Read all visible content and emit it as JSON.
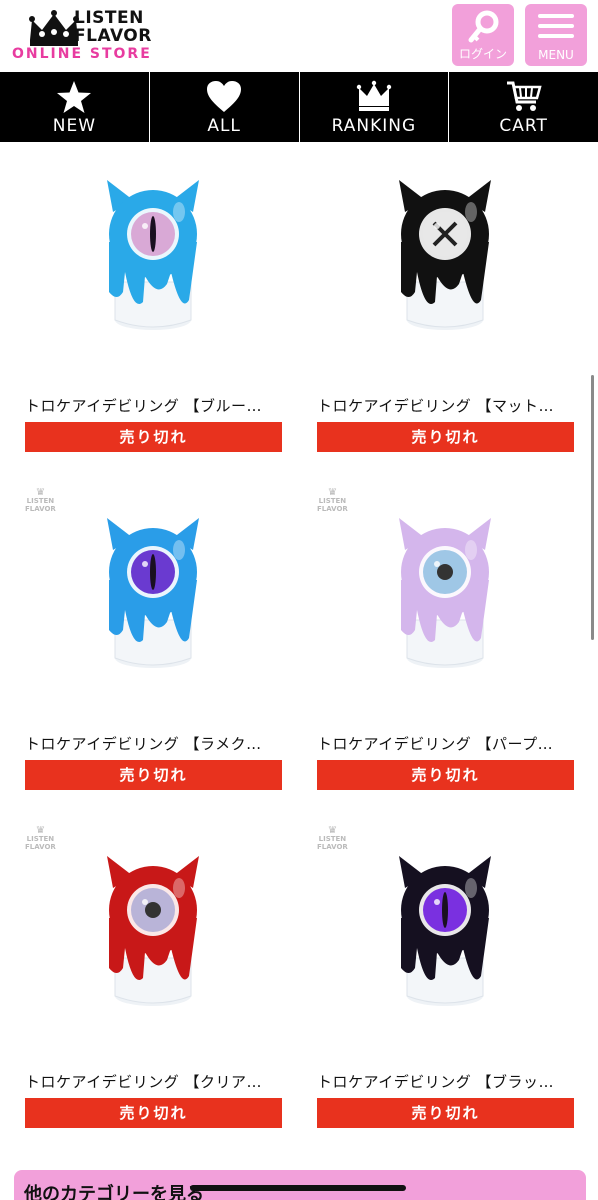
{
  "brand": {
    "line1": "LISTEN",
    "line2": "FLAVOR",
    "line3": "ONLINE STORE",
    "accent_color": "#e83ca0"
  },
  "header": {
    "login_label": "ログイン",
    "menu_label": "MENU",
    "button_color": "#f2a0da"
  },
  "nav": {
    "items": [
      {
        "label": "NEW",
        "icon": "star-icon"
      },
      {
        "label": "ALL",
        "icon": "heart-icon"
      },
      {
        "label": "RANKING",
        "icon": "crown-icon"
      },
      {
        "label": "CART",
        "icon": "cart-icon"
      }
    ]
  },
  "products": [
    {
      "name": "トロケアイデビリング 【ブルー…",
      "status": "売り切れ",
      "body_color": "#2aa9e8",
      "eye_color": "#d9a9d6",
      "pupil": "slit",
      "has_watermark": false
    },
    {
      "name": "トロケアイデビリング 【マット…",
      "status": "売り切れ",
      "body_color": "#111111",
      "eye_color": "#e8e8e8",
      "pupil": "x",
      "has_watermark": false
    },
    {
      "name": "トロケアイデビリング 【ラメク…",
      "status": "売り切れ",
      "body_color": "#2a9de8",
      "eye_color": "#6a3ad0",
      "pupil": "slit",
      "has_watermark": true
    },
    {
      "name": "トロケアイデビリング 【パープ…",
      "status": "売り切れ",
      "body_color": "#d4b6ec",
      "eye_color": "#9fc7e6",
      "pupil": "round",
      "has_watermark": true
    },
    {
      "name": "トロケアイデビリング 【クリア…",
      "status": "売り切れ",
      "body_color": "#c81818",
      "eye_color": "#b9b4d8",
      "pupil": "round",
      "has_watermark": true
    },
    {
      "name": "トロケアイデビリング 【ブラッ…",
      "status": "売り切れ",
      "body_color": "#151020",
      "eye_color": "#7a30e0",
      "pupil": "slit",
      "has_watermark": true
    }
  ],
  "watermark": {
    "line1": "LISTEN",
    "line2": "FLAVOR"
  },
  "footer": {
    "category_label": "他のカテゴリーを見る"
  },
  "sold_out_color": "#e8321e"
}
